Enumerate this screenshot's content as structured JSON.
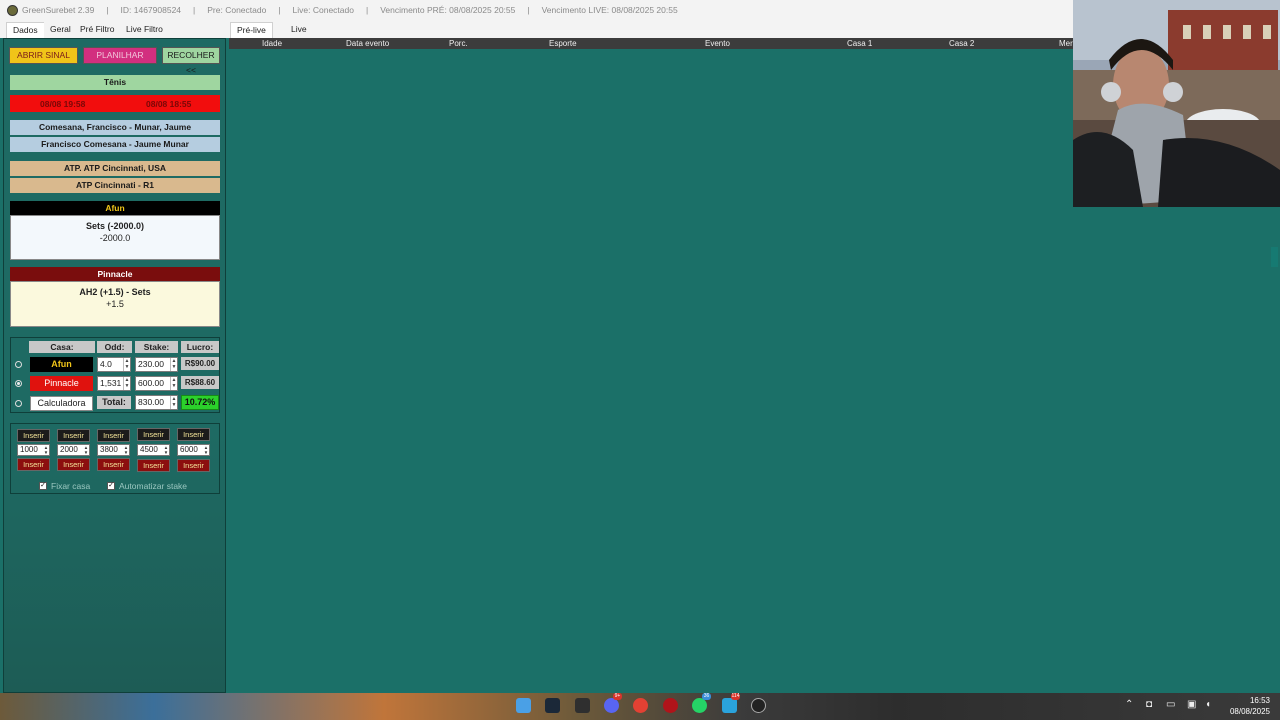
{
  "titlebar": {
    "app": "GreenSurebet 2.39",
    "id": "ID: 1467908524",
    "pre": "Pre: Conectado",
    "live": "Live: Conectado",
    "venc_pre": "Vencimento PRÉ: 08/08/2025 20:55",
    "venc_live": "Vencimento LIVE: 08/08/2025 20:55",
    "separator": "|"
  },
  "tabs": {
    "top": [
      "Dados",
      "Geral",
      "Pré Filtro",
      "Live Filtro"
    ],
    "right": [
      "Pré-live",
      "Live"
    ]
  },
  "actions": {
    "abrir": "ABRIR SINAL",
    "planilhar": "PLANILHAR",
    "recolher": "RECOLHER <<"
  },
  "signal": {
    "sport": "Tênis",
    "time1": "08/08 19:58",
    "time2": "08/08 18:55",
    "match1": "Comesana, Francisco - Munar, Jaume",
    "match2": "Francisco Comesana - Jaume Munar",
    "league1": "ATP. ATP Cincinnati, USA",
    "league2": "ATP Cincinnati - R1"
  },
  "house1": {
    "name": "Afun",
    "market": "Sets (-2000.0)",
    "line": "-2000.0"
  },
  "house2": {
    "name": "Pinnacle",
    "market": "AH2 (+1.5) - Sets",
    "line": "+1.5"
  },
  "calc": {
    "headers": [
      "Casa:",
      "Odd:",
      "Stake:",
      "Lucro:"
    ],
    "rows": [
      {
        "house": "Afun",
        "odd": "4.0",
        "stake": "230.00",
        "profit": "R$90.00"
      },
      {
        "house": "Pinnacle",
        "odd": "1,531",
        "stake": "600.00",
        "profit": "R$88.60"
      }
    ],
    "calculator": "Calculadora",
    "total_label": "Total:",
    "total": "830.00",
    "percent": "10.72%"
  },
  "stakes": {
    "insert_label": "Inserir",
    "values": [
      "1000",
      "2000",
      "3800",
      "4500",
      "6000"
    ]
  },
  "options": {
    "fixar": "Fixar casa",
    "automatizar": "Automatizar stake"
  },
  "grid": {
    "columns": [
      "Idade",
      "Data evento",
      "Porc.",
      "Esporte",
      "Evento",
      "Casa 1",
      "Casa 2",
      "Mer"
    ]
  },
  "taskbar": {
    "badges": [
      "9+",
      "36",
      "114"
    ],
    "time": "16:53",
    "date": "08/08/2025"
  },
  "colors": {
    "panel_teal": "#1e6a63",
    "grid_teal": "#1b7068",
    "accent_red": "#e0120e",
    "afun_black": "#000000",
    "pinnacle_maroon": "#7a0d0d",
    "profit_green": "#2bd12b"
  }
}
